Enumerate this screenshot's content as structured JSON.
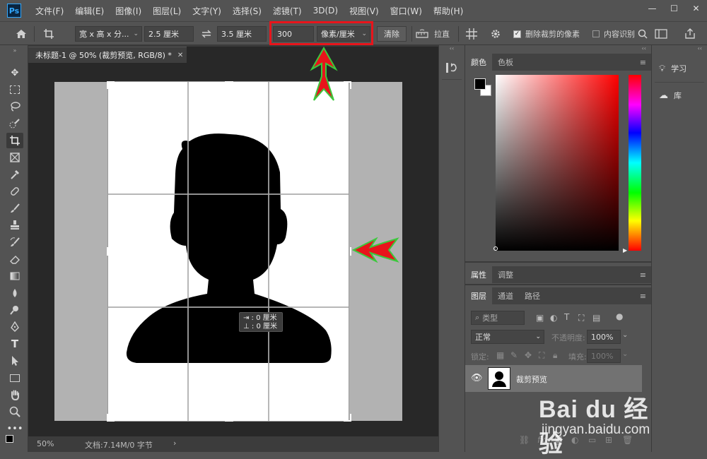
{
  "app": {
    "logo": "Ps"
  },
  "menu": [
    "文件(F)",
    "编辑(E)",
    "图像(I)",
    "图层(L)",
    "文字(Y)",
    "选择(S)",
    "滤镜(T)",
    "3D(D)",
    "视图(V)",
    "窗口(W)",
    "帮助(H)"
  ],
  "window_controls": {
    "minimize": "—",
    "maximize": "☐",
    "close": "✕"
  },
  "options": {
    "ratio_select": "宽 x 高 x 分...",
    "width": "2.5 厘米",
    "height": "3.5 厘米",
    "resolution": "300",
    "resolution_unit": "像素/厘米",
    "clear": "清除",
    "straighten": "拉直",
    "delete_cropped": "删除裁剪的像素",
    "delete_cropped_checked": true,
    "content_aware": "内容识别",
    "content_aware_checked": false
  },
  "document": {
    "tab_title": "未标题-1 @ 50% (裁剪预览, RGB/8) *",
    "tooltip_w": "⇥ : 0 厘米",
    "tooltip_h": "⊥ : 0 厘米",
    "zoom": "50%",
    "doc_size": "文档:7.14M/0 字节"
  },
  "panels": {
    "color_tabs": [
      "颜色",
      "色板"
    ],
    "props_tabs": [
      "属性",
      "调整"
    ],
    "layer_tabs": [
      "图层",
      "通道",
      "路径"
    ],
    "layer_filter": "类型",
    "blend_mode": "正常",
    "opacity_label": "不透明度:",
    "opacity": "100%",
    "lock_label": "锁定:",
    "fill_label": "填充:",
    "fill": "100%",
    "layer_name": "裁剪预览",
    "foreground_color": "#000000",
    "background_color": "#ffffff"
  },
  "learn": {
    "learn": "学习",
    "library": "库"
  },
  "watermark": {
    "logo": "Bai du 经验",
    "url": "jingyan.baidu.com"
  },
  "annotation": {
    "color": "#e8141b",
    "outline": "#3cc83c"
  }
}
